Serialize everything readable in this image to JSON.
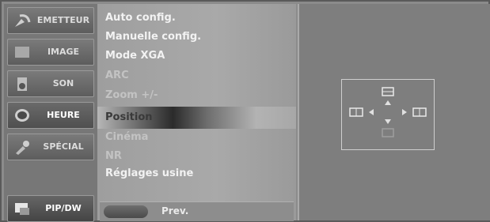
{
  "tabs": [
    {
      "label": "EMETTEUR",
      "icon": "satellite-dish-icon"
    },
    {
      "label": "IMAGE",
      "icon": "image-icon"
    },
    {
      "label": "SON",
      "icon": "speaker-icon"
    },
    {
      "label": "HEURE",
      "icon": "clock-icon"
    },
    {
      "label": "SPÉCIAL",
      "icon": "wrench-icon"
    }
  ],
  "pip_tab": {
    "label": "PIP/DW",
    "icon": "pip-icon"
  },
  "menu": {
    "items": [
      "Auto config.",
      "Manuelle config.",
      "Mode XGA",
      "ARC",
      "Zoom +/-",
      "Position",
      "Cinéma",
      "NR",
      "Réglages usine"
    ],
    "prev_label": "Prev."
  },
  "position_diagram": {
    "icons": [
      "arrow-up-icon",
      "arrow-down-icon",
      "arrow-left-icon",
      "arrow-right-icon"
    ]
  }
}
